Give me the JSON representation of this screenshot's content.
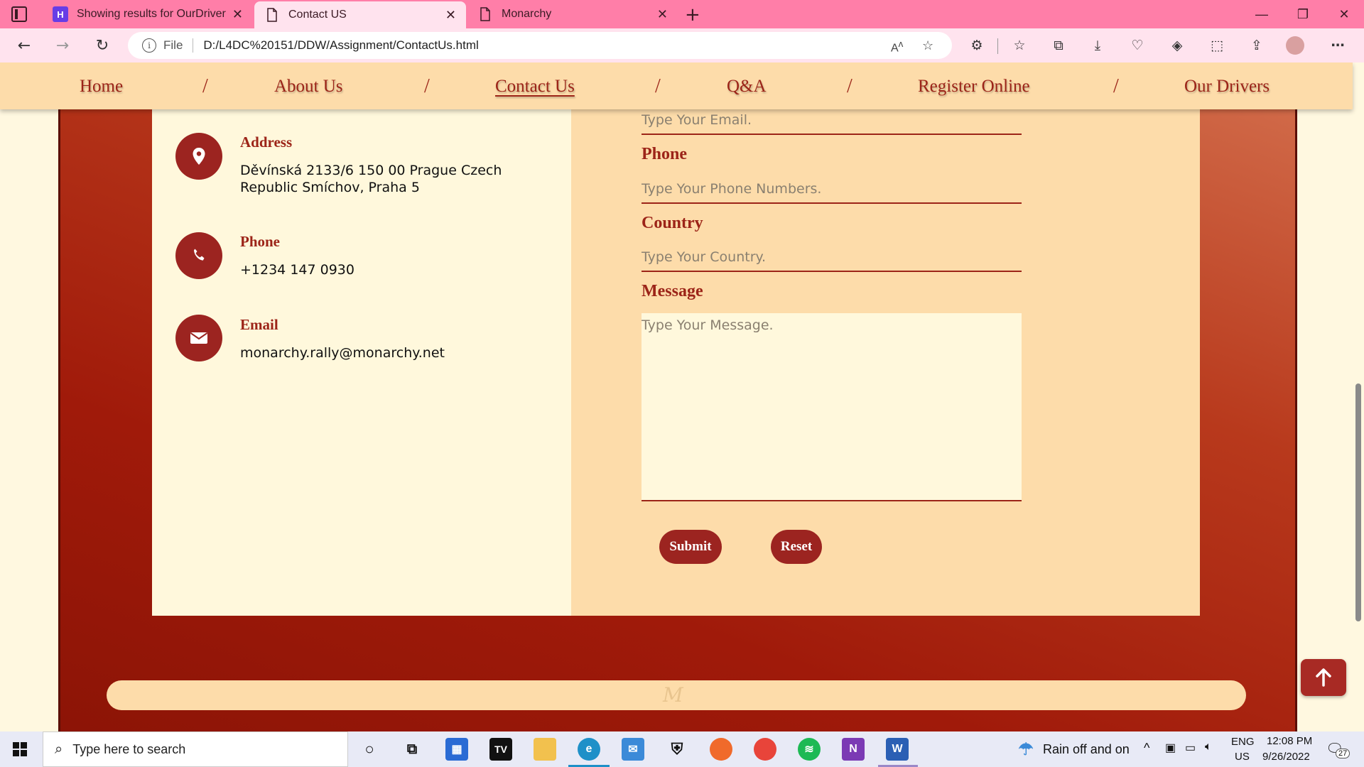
{
  "browser": {
    "tabs": [
      {
        "title": "Showing results for OurDrivers.h",
        "active": false,
        "favicon": "hostinger-icon"
      },
      {
        "title": "Contact US",
        "active": true,
        "favicon": "page-icon"
      },
      {
        "title": "Monarchy",
        "active": false,
        "favicon": "page-icon"
      }
    ],
    "url_prefix": "File",
    "url": "D:/L4DC%20151/DDW/Assignment/ContactUs.html"
  },
  "nav": {
    "items": [
      "Home",
      "About Us",
      "Contact Us",
      "Q&A",
      "Register Online",
      "Our Drivers"
    ],
    "separator": "/",
    "active": "Contact Us"
  },
  "contact_info": {
    "address_title": "Address",
    "address_line1": "Děvínská 2133/6 150 00 Prague Czech",
    "address_line2": "Republic Smíchov, Praha 5",
    "phone_title": "Phone",
    "phone": "+1234 147 0930",
    "email_title": "Email",
    "email": "monarchy.rally@monarchy.net"
  },
  "form": {
    "email_placeholder": "Type Your Email.",
    "phone_label": "Phone",
    "phone_placeholder": "Type Your Phone Numbers.",
    "country_label": "Country",
    "country_placeholder": "Type Your Country.",
    "message_label": "Message",
    "message_placeholder": "Type Your Message.",
    "submit_label": "Submit",
    "reset_label": "Reset"
  },
  "footer": {
    "logo": "M"
  },
  "taskbar": {
    "search_placeholder": "Type here to search",
    "weather": "Rain off and on",
    "lang_line1": "ENG",
    "lang_line2": "US",
    "time": "12:08 PM",
    "date": "9/26/2022",
    "notifications": "27"
  },
  "colors": {
    "tabbar": "#ff7ea8",
    "nav_bg": "#fddcaa",
    "accent": "#9c2418",
    "frame_gradient_start": "#d4704e",
    "frame_gradient_end": "#8c1406"
  }
}
